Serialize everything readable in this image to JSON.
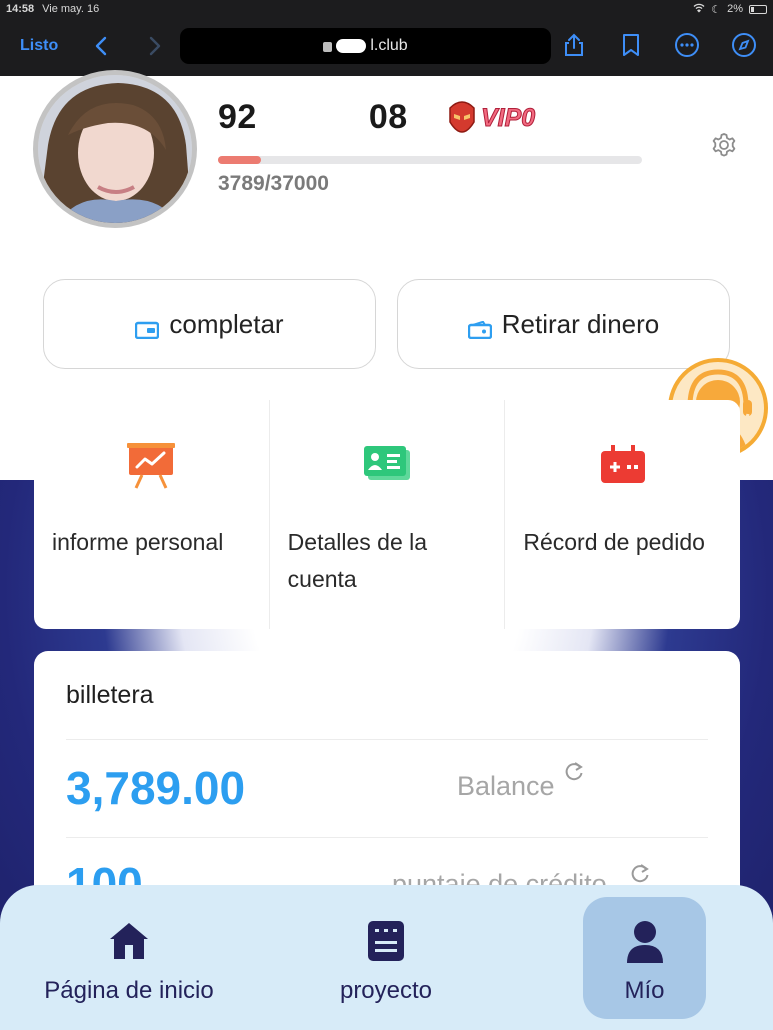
{
  "status_bar": {
    "time": "14:58",
    "date": "Vie may. 16",
    "battery": "2%"
  },
  "browser": {
    "done_label": "Listo",
    "url_visible": "l.club"
  },
  "profile": {
    "username_start": "92",
    "username_end": "08",
    "vip_label": "VIP0",
    "progress_text": "3789/37000",
    "progress_fraction": 0.1024
  },
  "actions": {
    "complete_label": "completar",
    "withdraw_label": "Retirar dinero"
  },
  "features": [
    {
      "label": "informe personal"
    },
    {
      "label": "Detalles de la cuenta"
    },
    {
      "label": "Récord de pedido"
    }
  ],
  "wallet": {
    "title": "billetera",
    "balance_value": "3,789.00",
    "balance_label": "Balance",
    "credit_value": "100",
    "credit_label": "puntaje de crédito"
  },
  "bottom_nav": {
    "home_label": "Página de inicio",
    "project_label": "proyecto",
    "mine_label": "Mío",
    "active": "Mío"
  },
  "colors": {
    "accent_blue": "#2c9ef0",
    "nav_active": "#a7c7e6",
    "progress": "#ec7b71",
    "nav_bg": "#d7ebf8"
  }
}
